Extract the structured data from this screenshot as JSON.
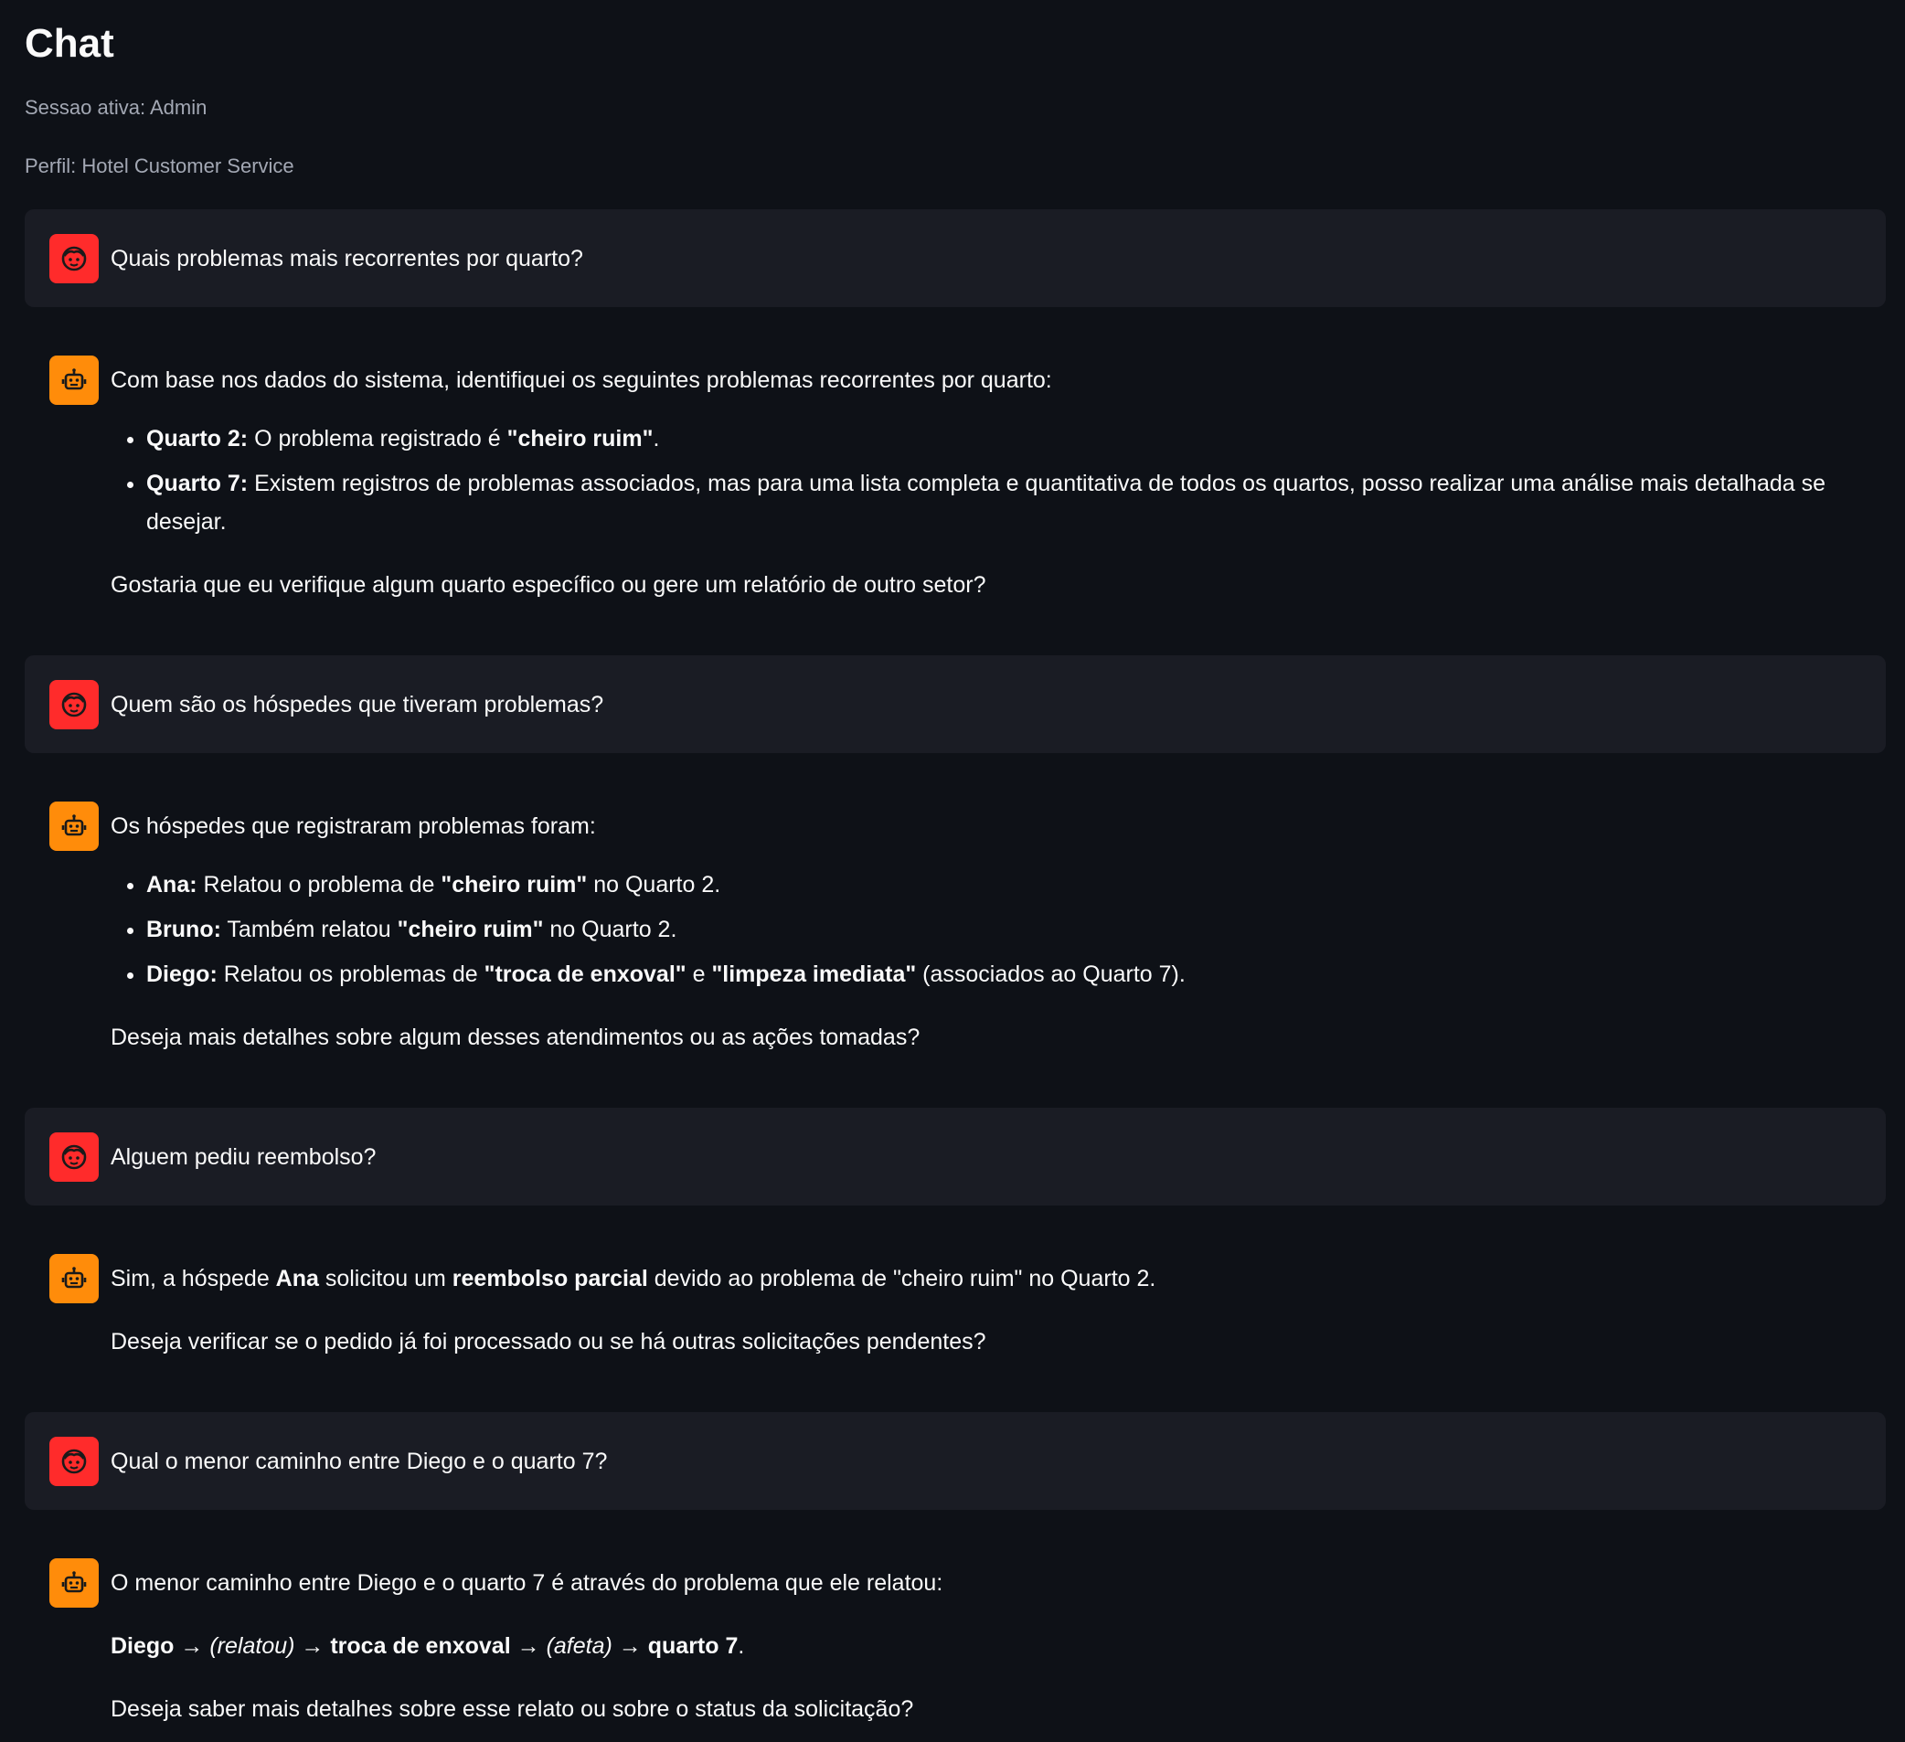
{
  "page": {
    "title": "Chat",
    "session_label": "Sessao ativa: Admin",
    "profile_label": "Perfil: Hotel Customer Service"
  },
  "colors": {
    "background": "#0e1117",
    "user_bubble": "#1a1c24",
    "user_avatar": "#ff2b2b",
    "assistant_avatar": "#ff8c0a",
    "muted_text": "#a3a8b4"
  },
  "icons": {
    "user_avatar": "user-face-icon",
    "assistant_avatar": "robot-icon"
  },
  "messages": [
    {
      "role": "user",
      "text": "Quais problemas mais recorrentes por quarto?"
    },
    {
      "role": "assistant",
      "intro": "Com base nos dados do sistema, identifiquei os seguintes problemas recorrentes por quarto:",
      "items": [
        {
          "label": "Quarto 2:",
          "pre": " O problema registrado é ",
          "bold": "\"cheiro ruim\"",
          "post": "."
        },
        {
          "label": "Quarto 7:",
          "pre": " Existem registros de problemas associados, mas para uma lista completa e quantitativa de todos os quartos, posso realizar uma análise mais detalhada se desejar.",
          "bold": "",
          "post": ""
        }
      ],
      "closing": "Gostaria que eu verifique algum quarto específico ou gere um relatório de outro setor?"
    },
    {
      "role": "user",
      "text": "Quem são os hóspedes que tiveram problemas?"
    },
    {
      "role": "assistant",
      "intro": "Os hóspedes que registraram problemas foram:",
      "items": [
        {
          "label": "Ana:",
          "pre": " Relatou o problema de ",
          "bold": "\"cheiro ruim\"",
          "post": " no Quarto 2."
        },
        {
          "label": "Bruno:",
          "pre": " Também relatou ",
          "bold": "\"cheiro ruim\"",
          "post": " no Quarto 2."
        },
        {
          "label": "Diego:",
          "pre": " Relatou os problemas de ",
          "bold": "\"troca de enxoval\"",
          "mid": " e ",
          "bold2": "\"limpeza imediata\"",
          "post": " (associados ao Quarto 7)."
        }
      ],
      "closing": "Deseja mais detalhes sobre algum desses atendimentos ou as ações tomadas?"
    },
    {
      "role": "user",
      "text": "Alguem pediu reembolso?"
    },
    {
      "role": "assistant",
      "line1_a": "Sim, a hóspede ",
      "line1_b": "Ana",
      "line1_c": " solicitou um ",
      "line1_d": "reembolso parcial",
      "line1_e": " devido ao problema de \"cheiro ruim\" no Quarto 2.",
      "closing": "Deseja verificar se o pedido já foi processado ou se há outras solicitações pendentes?"
    },
    {
      "role": "user",
      "text": "Qual o menor caminho entre Diego e o quarto 7?"
    },
    {
      "role": "assistant",
      "intro": "O menor caminho entre Diego e o quarto 7 é através do problema que ele relatou:",
      "path": {
        "n1": "Diego",
        "a1": " → ",
        "e1": "(relatou)",
        "a2": " → ",
        "n2": "troca de enxoval",
        "a3": " → ",
        "e2": "(afeta)",
        "a4": " → ",
        "n3": "quarto 7",
        "end": "."
      },
      "closing": "Deseja saber mais detalhes sobre esse relato ou sobre o status da solicitação?"
    }
  ]
}
